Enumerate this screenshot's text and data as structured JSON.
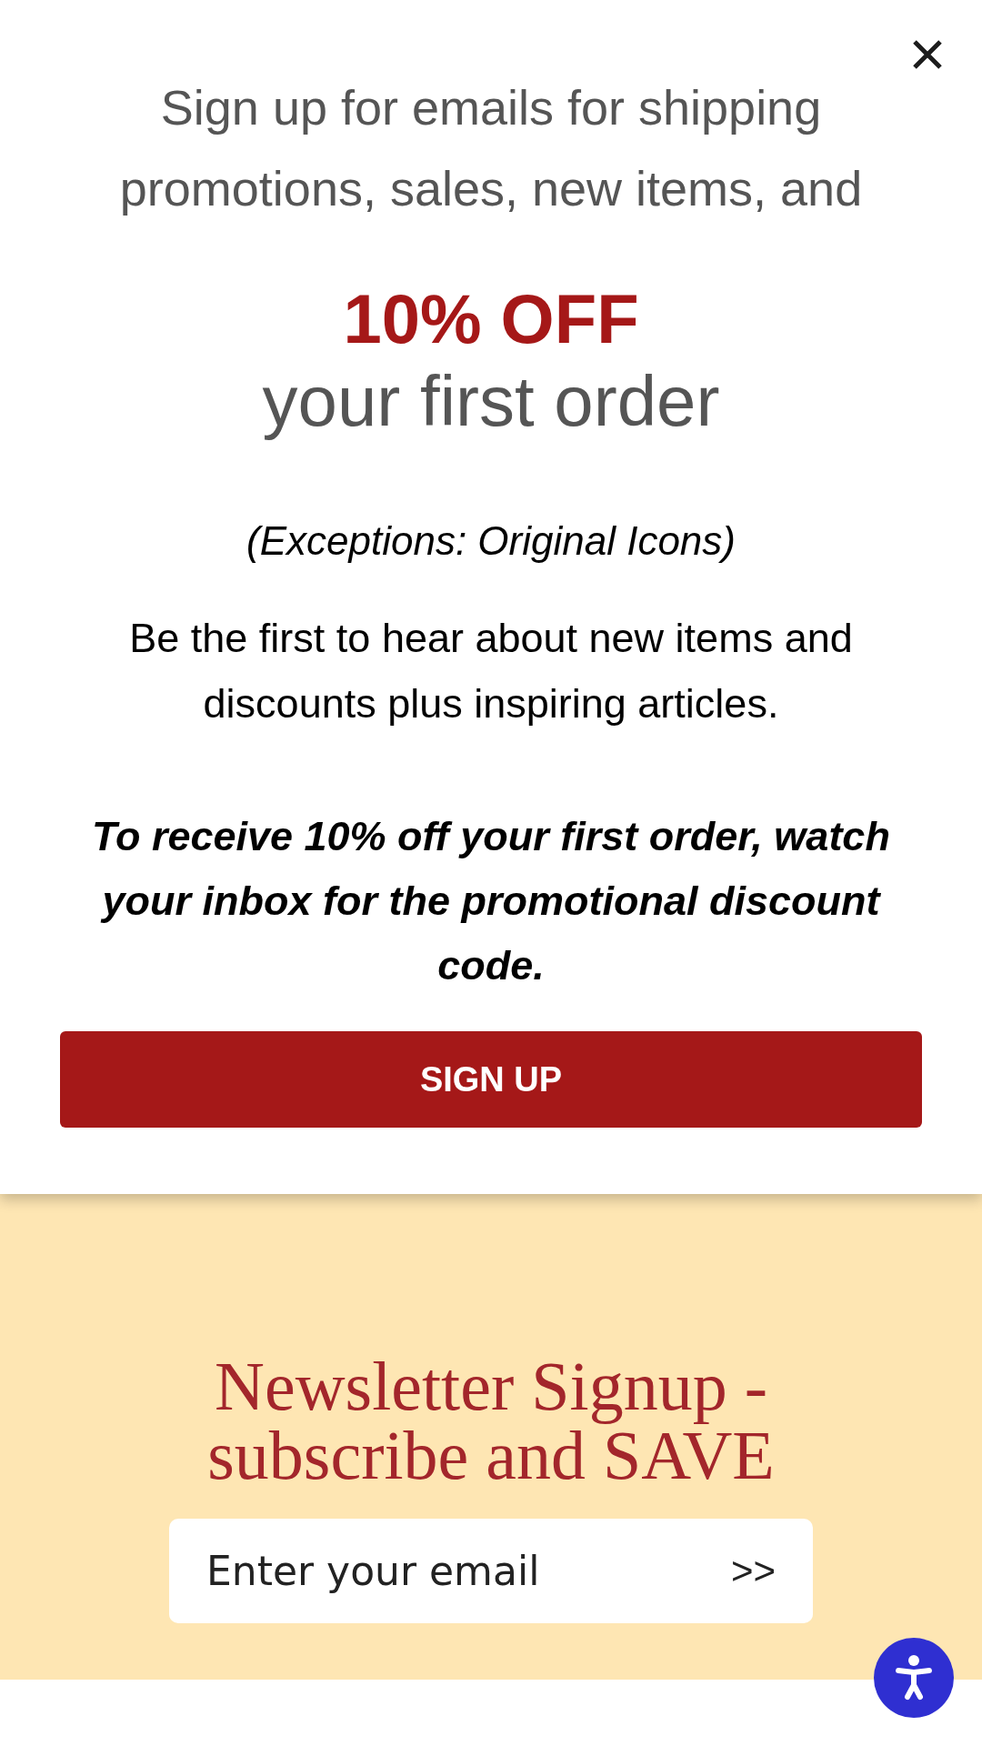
{
  "popup": {
    "intro": "Sign up for emails for shipping promotions, sales, new items, and",
    "offer": "10% OFF",
    "offer_suffix": "your first order",
    "exceptions": "(Exceptions: Original Icons)",
    "description": "Be the first to hear about new items and discounts plus inspiring articles.",
    "note": "To receive 10% off your first order, watch your inbox for the promotional discount code.",
    "button": "SIGN UP"
  },
  "newsletter": {
    "heading": "Newsletter Signup - subscribe and SAVE",
    "email_field": {
      "placeholder": "Enter your email"
    },
    "submit": ">>"
  }
}
